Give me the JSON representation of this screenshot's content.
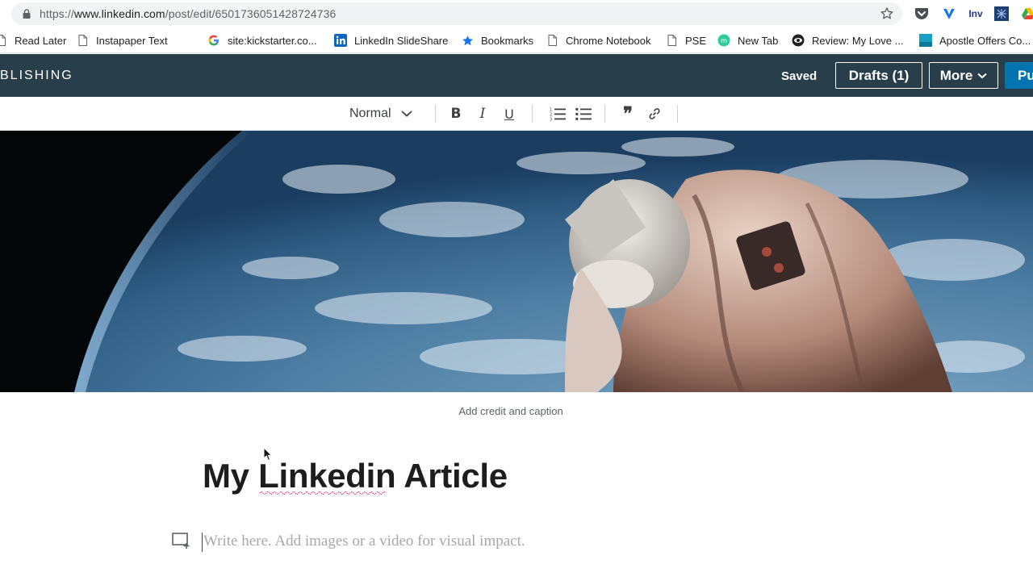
{
  "browser": {
    "url_prefix": "https://",
    "url_host": "www.linkedin.com",
    "url_path": "/post/edit/6501736051428724736",
    "bookmarks": [
      {
        "label": "Read Later",
        "icon": "page-icon"
      },
      {
        "label": "Instapaper Text",
        "icon": "page-icon"
      },
      {
        "label": "site:kickstarter.co...",
        "icon": "google-icon"
      },
      {
        "label": "LinkedIn SlideShare",
        "icon": "linkedin-icon"
      },
      {
        "label": "Bookmarks",
        "icon": "star-icon"
      },
      {
        "label": "Chrome Notebook",
        "icon": "page-icon"
      },
      {
        "label": "PSE",
        "icon": "page-icon"
      },
      {
        "label": "New Tab",
        "icon": "green-circle-icon"
      },
      {
        "label": "Review: My Love ...",
        "icon": "eye-icon"
      },
      {
        "label": "Apostle Offers Co...",
        "icon": "teal-square-icon"
      }
    ],
    "extensions": [
      {
        "name": "pocket-icon"
      },
      {
        "name": "v-icon"
      },
      {
        "label": "Inv",
        "name": "inv-icon"
      },
      {
        "name": "network-icon"
      },
      {
        "name": "drive-icon"
      }
    ]
  },
  "header": {
    "brand": "BLISHING",
    "saved": "Saved",
    "drafts": "Drafts (1)",
    "more": "More",
    "publish": "Pu"
  },
  "toolbar": {
    "style": "Normal",
    "bold": "B",
    "italic": "I",
    "underline": "U",
    "quote": "❞"
  },
  "editor": {
    "caption": "Add credit and caption",
    "title": "My Linkedin Article",
    "body_placeholder": "Write here. Add images or a video for visual impact."
  },
  "colors": {
    "header_bg": "#283e4a",
    "publish_blue": "#0073b1"
  }
}
